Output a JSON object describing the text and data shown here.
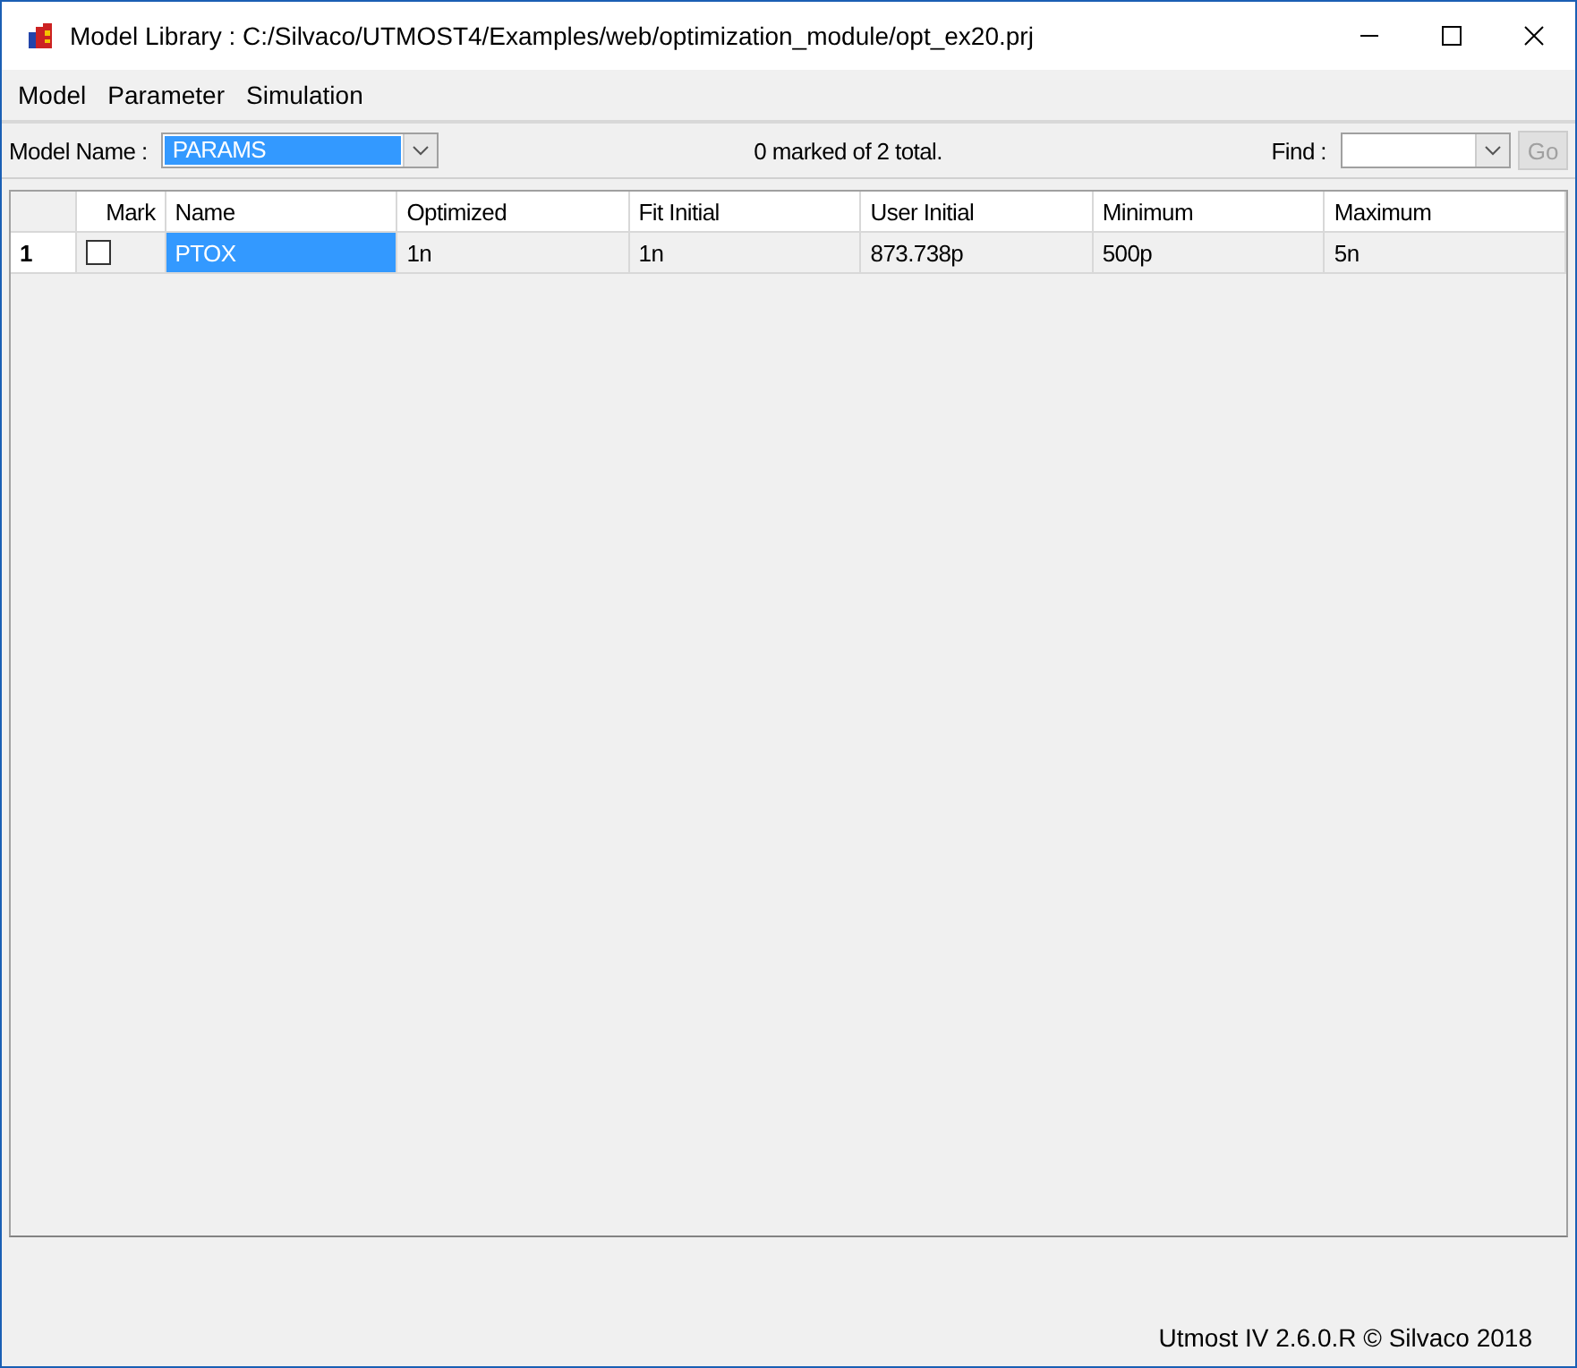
{
  "window": {
    "title": "Model Library : C:/Silvaco/UTMOST4/Examples/web/optimization_module/opt_ex20.prj"
  },
  "menu": [
    "Model",
    "Parameter",
    "Simulation"
  ],
  "toolbar": {
    "model_name_label": "Model Name :",
    "model_name": "PARAMS",
    "count_text": "0 marked of 2 total.",
    "find_label": "Find :",
    "go_button": {
      "label": "Go",
      "disabled": true
    }
  },
  "table": {
    "columns": [
      "Mark",
      "Name",
      "Optimized",
      "Fit Initial",
      "User Initial",
      "Minimum",
      "Maximum"
    ],
    "rows": [
      {
        "header": "1",
        "cells": [
          {
            "kind": "checkbox",
            "checked": false
          },
          {
            "kind": "text",
            "text": "PTOX",
            "selected": true
          },
          {
            "kind": "text",
            "text": "1n",
            "selected": false
          },
          {
            "kind": "text",
            "text": "1n",
            "selected": false
          },
          {
            "kind": "text",
            "text": "873.738p",
            "selected": false
          },
          {
            "kind": "text",
            "text": "500p",
            "selected": false
          },
          {
            "kind": "text",
            "text": "5n",
            "selected": false
          }
        ]
      }
    ]
  },
  "status_bar": "Utmost IV 2.6.0.R © Silvaco 2018"
}
